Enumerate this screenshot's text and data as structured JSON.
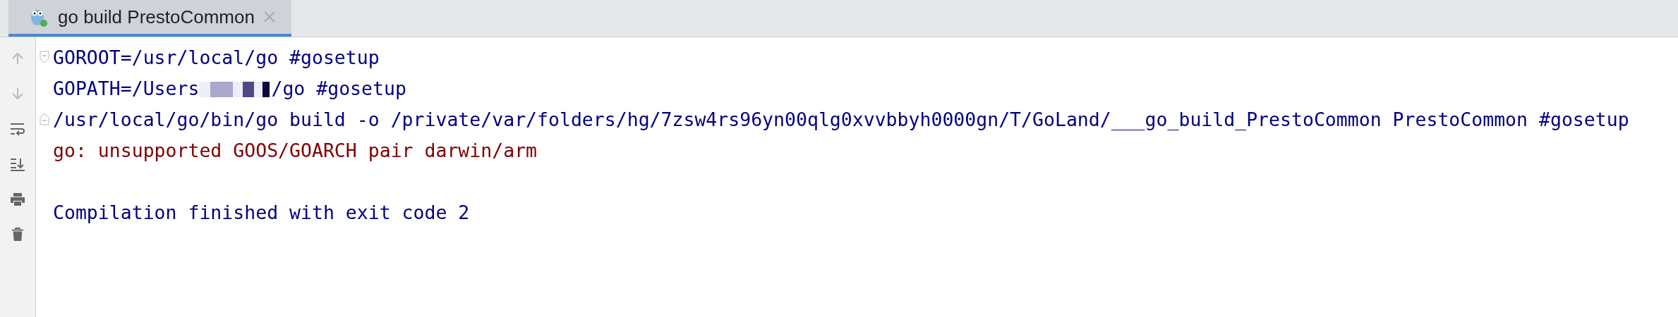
{
  "tabs": [
    {
      "label": "go build PrestoCommon",
      "selected": true
    }
  ],
  "console": {
    "lines": [
      {
        "kind": "fold-start",
        "color": "#000080",
        "text": "GOROOT=/usr/local/go #gosetup"
      },
      {
        "kind": "redacted",
        "color": "#000080",
        "text": "GOPATH=/Users",
        "text_after": "/go #gosetup"
      },
      {
        "kind": "fold-end",
        "color": "#000080",
        "text": "/usr/local/go/bin/go build -o /private/var/folders/hg/7zsw4rs96yn00qlg0xvvbbyh0000gn/T/GoLand/___go_build_PrestoCommon PrestoCommon #gosetup"
      },
      {
        "kind": "plain",
        "color": "#7f0000",
        "text": "go: unsupported GOOS/GOARCH pair darwin/arm"
      },
      {
        "kind": "blank"
      },
      {
        "kind": "plain",
        "color": "#000080",
        "text": "Compilation finished with exit code 2"
      }
    ]
  }
}
